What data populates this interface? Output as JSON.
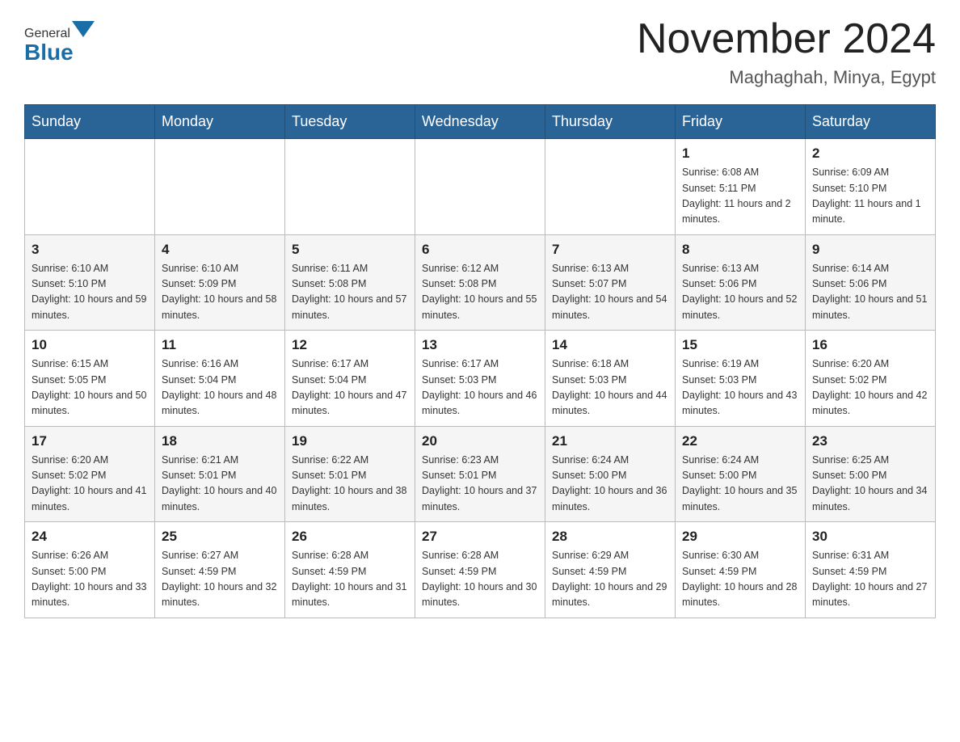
{
  "header": {
    "logo": {
      "general": "General",
      "blue": "Blue"
    },
    "title": "November 2024",
    "location": "Maghaghah, Minya, Egypt"
  },
  "weekdays": [
    "Sunday",
    "Monday",
    "Tuesday",
    "Wednesday",
    "Thursday",
    "Friday",
    "Saturday"
  ],
  "weeks": [
    [
      {
        "day": "",
        "info": ""
      },
      {
        "day": "",
        "info": ""
      },
      {
        "day": "",
        "info": ""
      },
      {
        "day": "",
        "info": ""
      },
      {
        "day": "",
        "info": ""
      },
      {
        "day": "1",
        "info": "Sunrise: 6:08 AM\nSunset: 5:11 PM\nDaylight: 11 hours and 2 minutes."
      },
      {
        "day": "2",
        "info": "Sunrise: 6:09 AM\nSunset: 5:10 PM\nDaylight: 11 hours and 1 minute."
      }
    ],
    [
      {
        "day": "3",
        "info": "Sunrise: 6:10 AM\nSunset: 5:10 PM\nDaylight: 10 hours and 59 minutes."
      },
      {
        "day": "4",
        "info": "Sunrise: 6:10 AM\nSunset: 5:09 PM\nDaylight: 10 hours and 58 minutes."
      },
      {
        "day": "5",
        "info": "Sunrise: 6:11 AM\nSunset: 5:08 PM\nDaylight: 10 hours and 57 minutes."
      },
      {
        "day": "6",
        "info": "Sunrise: 6:12 AM\nSunset: 5:08 PM\nDaylight: 10 hours and 55 minutes."
      },
      {
        "day": "7",
        "info": "Sunrise: 6:13 AM\nSunset: 5:07 PM\nDaylight: 10 hours and 54 minutes."
      },
      {
        "day": "8",
        "info": "Sunrise: 6:13 AM\nSunset: 5:06 PM\nDaylight: 10 hours and 52 minutes."
      },
      {
        "day": "9",
        "info": "Sunrise: 6:14 AM\nSunset: 5:06 PM\nDaylight: 10 hours and 51 minutes."
      }
    ],
    [
      {
        "day": "10",
        "info": "Sunrise: 6:15 AM\nSunset: 5:05 PM\nDaylight: 10 hours and 50 minutes."
      },
      {
        "day": "11",
        "info": "Sunrise: 6:16 AM\nSunset: 5:04 PM\nDaylight: 10 hours and 48 minutes."
      },
      {
        "day": "12",
        "info": "Sunrise: 6:17 AM\nSunset: 5:04 PM\nDaylight: 10 hours and 47 minutes."
      },
      {
        "day": "13",
        "info": "Sunrise: 6:17 AM\nSunset: 5:03 PM\nDaylight: 10 hours and 46 minutes."
      },
      {
        "day": "14",
        "info": "Sunrise: 6:18 AM\nSunset: 5:03 PM\nDaylight: 10 hours and 44 minutes."
      },
      {
        "day": "15",
        "info": "Sunrise: 6:19 AM\nSunset: 5:03 PM\nDaylight: 10 hours and 43 minutes."
      },
      {
        "day": "16",
        "info": "Sunrise: 6:20 AM\nSunset: 5:02 PM\nDaylight: 10 hours and 42 minutes."
      }
    ],
    [
      {
        "day": "17",
        "info": "Sunrise: 6:20 AM\nSunset: 5:02 PM\nDaylight: 10 hours and 41 minutes."
      },
      {
        "day": "18",
        "info": "Sunrise: 6:21 AM\nSunset: 5:01 PM\nDaylight: 10 hours and 40 minutes."
      },
      {
        "day": "19",
        "info": "Sunrise: 6:22 AM\nSunset: 5:01 PM\nDaylight: 10 hours and 38 minutes."
      },
      {
        "day": "20",
        "info": "Sunrise: 6:23 AM\nSunset: 5:01 PM\nDaylight: 10 hours and 37 minutes."
      },
      {
        "day": "21",
        "info": "Sunrise: 6:24 AM\nSunset: 5:00 PM\nDaylight: 10 hours and 36 minutes."
      },
      {
        "day": "22",
        "info": "Sunrise: 6:24 AM\nSunset: 5:00 PM\nDaylight: 10 hours and 35 minutes."
      },
      {
        "day": "23",
        "info": "Sunrise: 6:25 AM\nSunset: 5:00 PM\nDaylight: 10 hours and 34 minutes."
      }
    ],
    [
      {
        "day": "24",
        "info": "Sunrise: 6:26 AM\nSunset: 5:00 PM\nDaylight: 10 hours and 33 minutes."
      },
      {
        "day": "25",
        "info": "Sunrise: 6:27 AM\nSunset: 4:59 PM\nDaylight: 10 hours and 32 minutes."
      },
      {
        "day": "26",
        "info": "Sunrise: 6:28 AM\nSunset: 4:59 PM\nDaylight: 10 hours and 31 minutes."
      },
      {
        "day": "27",
        "info": "Sunrise: 6:28 AM\nSunset: 4:59 PM\nDaylight: 10 hours and 30 minutes."
      },
      {
        "day": "28",
        "info": "Sunrise: 6:29 AM\nSunset: 4:59 PM\nDaylight: 10 hours and 29 minutes."
      },
      {
        "day": "29",
        "info": "Sunrise: 6:30 AM\nSunset: 4:59 PM\nDaylight: 10 hours and 28 minutes."
      },
      {
        "day": "30",
        "info": "Sunrise: 6:31 AM\nSunset: 4:59 PM\nDaylight: 10 hours and 27 minutes."
      }
    ]
  ]
}
